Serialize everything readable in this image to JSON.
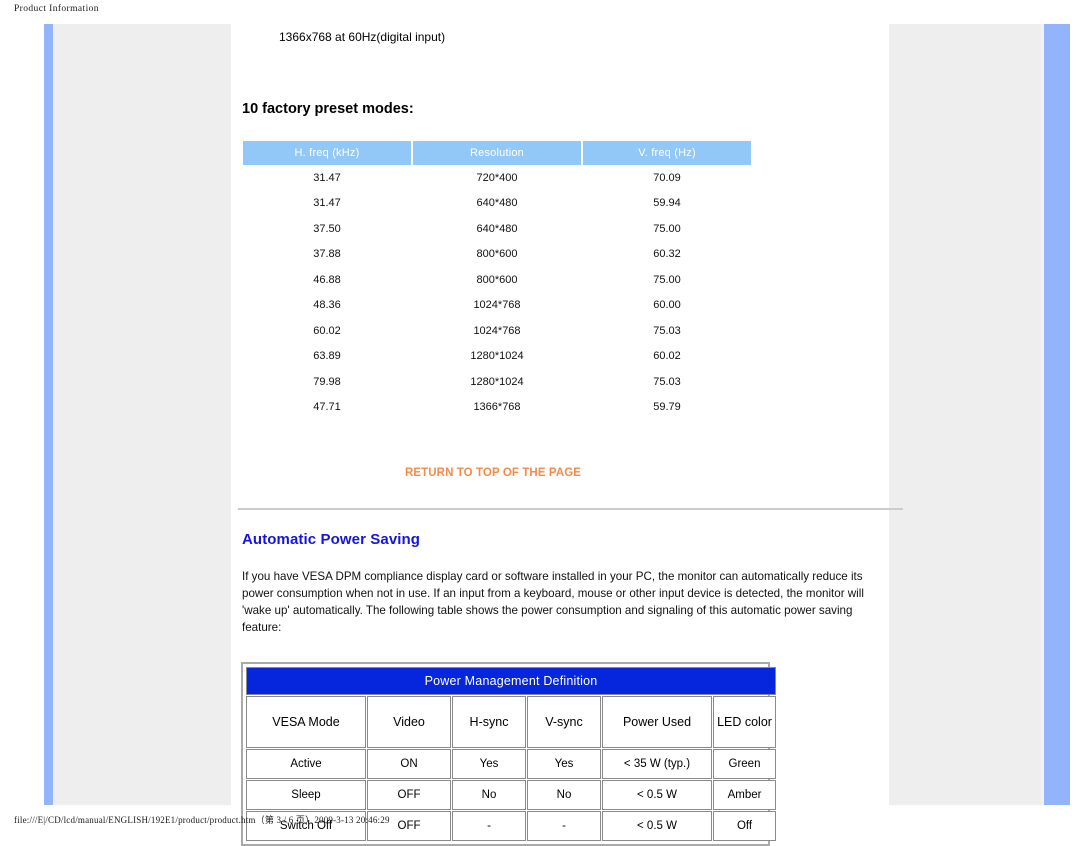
{
  "print_header": "Product Information",
  "print_footer": "file:///E|/CD/lcd/manual/ENGLISH/192E1/product/product.htm（第 3 / 6 页）2009-3-13 20:46:29",
  "content": {
    "mode_line": "1366x768 at 60Hz(digital input)",
    "preset_heading": "10 factory preset modes:",
    "preset_table": {
      "headers": [
        "H. freq (kHz)",
        "Resolution",
        "V. freq (Hz)"
      ],
      "rows": [
        [
          "31.47",
          "720*400",
          "70.09"
        ],
        [
          "31.47",
          "640*480",
          "59.94"
        ],
        [
          "37.50",
          "640*480",
          "75.00"
        ],
        [
          "37.88",
          "800*600",
          "60.32"
        ],
        [
          "46.88",
          "800*600",
          "75.00"
        ],
        [
          "48.36",
          "1024*768",
          "60.00"
        ],
        [
          "60.02",
          "1024*768",
          "75.03"
        ],
        [
          "63.89",
          "1280*1024",
          "60.02"
        ],
        [
          "79.98",
          "1280*1024",
          "75.03"
        ],
        [
          "47.71",
          "1366*768",
          "59.79"
        ]
      ]
    },
    "return_link": "RETURN TO TOP OF THE PAGE",
    "power_saving": {
      "title": "Automatic Power Saving",
      "paragraph": "If you have VESA DPM compliance display card or software installed in your PC, the monitor can automatically reduce its power consumption when not in use. If an input from a keyboard, mouse or other input device is detected, the monitor will 'wake up' automatically. The following table shows the power consumption and signaling of this automatic power saving feature:",
      "table": {
        "banner": "Power Management Definition",
        "headers": [
          "VESA Mode",
          "Video",
          "H-sync",
          "V-sync",
          "Power Used",
          "LED color"
        ],
        "rows": [
          [
            "Active",
            "ON",
            "Yes",
            "Yes",
            "< 35 W (typ.)",
            "Green"
          ],
          [
            "Sleep",
            "OFF",
            "No",
            "No",
            "< 0.5 W",
            "Amber"
          ],
          [
            "Switch Off",
            "OFF",
            "-",
            "-",
            "< 0.5 W",
            "Off"
          ]
        ]
      }
    }
  },
  "colors": {
    "accent_blue": "#0526DC",
    "table_header_blue": "#92c8f8",
    "link_orange": "#F58B49",
    "sidebar_blue": "#93b4fb",
    "panel_gray": "#eeeeee"
  }
}
